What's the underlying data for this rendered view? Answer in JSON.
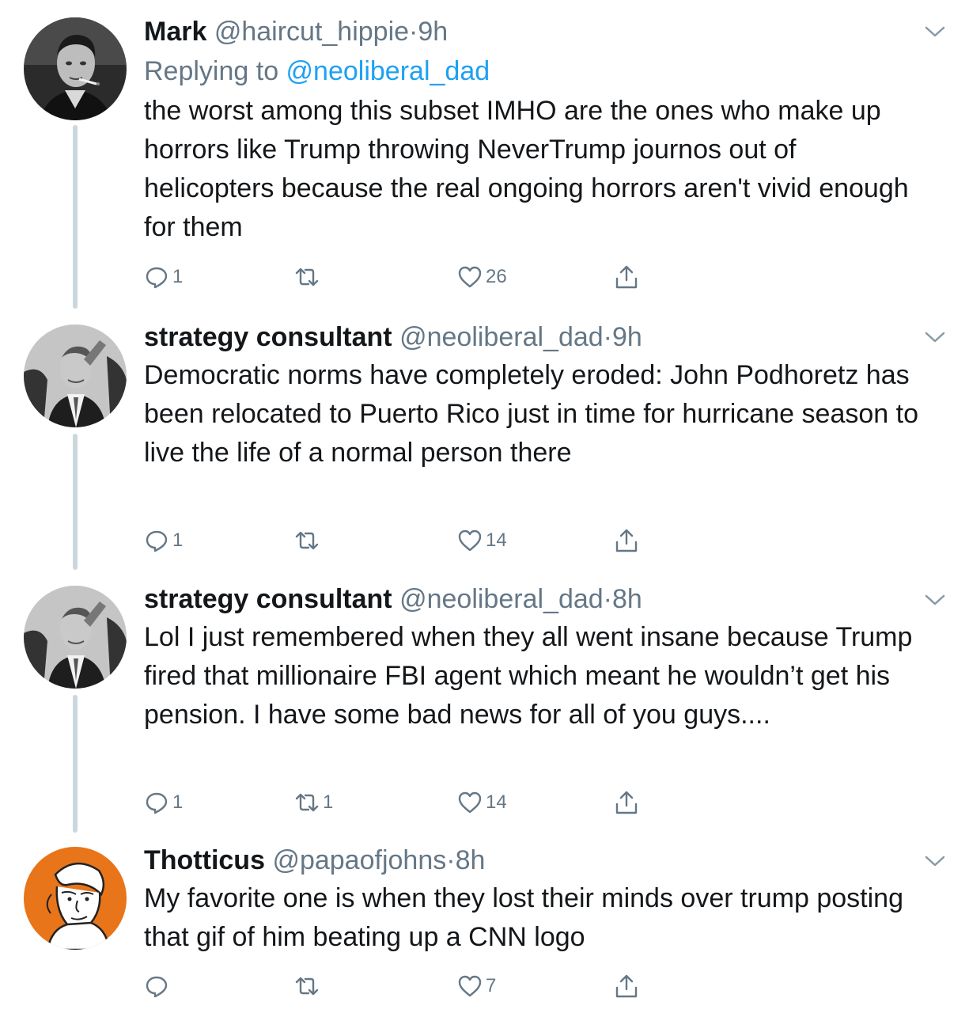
{
  "tweets": [
    {
      "name": "Mark",
      "handle": "@haircut_hippie",
      "dot": "·",
      "time": "9h",
      "reply_prefix": "Replying to ",
      "reply_mention": "@neoliberal_dad",
      "text": "the worst among this subset IMHO are the ones who make up horrors like Trump throwing NeverTrump journos out of helicopters because the real ongoing horrors aren't vivid enough for them",
      "replies": "1",
      "retweets": "",
      "likes": "26",
      "avatar_icon": "portrait-smoking-man"
    },
    {
      "name": "strategy consultant",
      "handle": "@neoliberal_dad",
      "dot": "·",
      "time": "9h",
      "text": "Democratic norms have completely eroded: John Podhoretz has been relocated to Puerto Rico just in time for hurricane season to live the life of a normal person there",
      "replies": "1",
      "retweets": "",
      "likes": "14",
      "avatar_icon": "portrait-man-in-suit"
    },
    {
      "name": "strategy consultant",
      "handle": "@neoliberal_dad",
      "dot": "·",
      "time": "8h",
      "text": "Lol I just remembered when they all went insane because Trump fired that millionaire FBI agent which meant he wouldn’t get his pension.  I have some bad news for all of you guys....",
      "replies": "1",
      "retweets": "1",
      "likes": "14",
      "avatar_icon": "portrait-man-in-suit"
    },
    {
      "name": "Thotticus",
      "handle": "@papaofjohns",
      "dot": "·",
      "time": "8h",
      "text": "My favorite one is when they lost their minds over trump posting that gif of him beating up a CNN logo",
      "replies": "",
      "retweets": "",
      "likes": "7",
      "avatar_icon": "sketch-woman-orange"
    }
  ],
  "colors": {
    "text": "#14171a",
    "secondary": "#657786",
    "link": "#1da1f2",
    "thread_line": "#ccd6dd",
    "avatar_orange": "#e8751a"
  },
  "icons": {
    "reply": "reply-icon",
    "retweet": "retweet-icon",
    "like": "heart-icon",
    "share": "share-icon",
    "more": "chevron-down-icon"
  }
}
